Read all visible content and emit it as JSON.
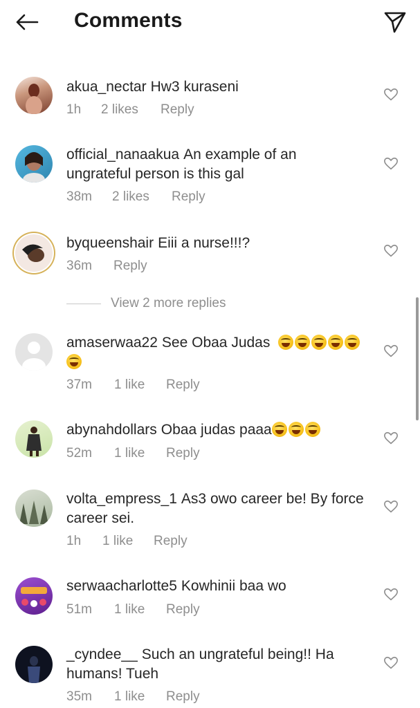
{
  "header": {
    "title": "Comments",
    "back_icon": "arrow-left-icon",
    "send_icon": "paper-plane-icon"
  },
  "comments": [
    {
      "username": "akua_nectar",
      "text": "Hw3 kuraseni",
      "time": "1h",
      "likes": "2 likes",
      "reply": "Reply",
      "avatar_colors": [
        "#7a3d2c",
        "#e8b59a"
      ]
    },
    {
      "username": "official_nanaakua",
      "text": "An example of an ungrateful person is this gal",
      "time": "38m",
      "likes": "2 likes",
      "reply": "Reply",
      "avatar_colors": [
        "#3fa0c8",
        "#b07a63"
      ]
    },
    {
      "username": "byqueenshair",
      "text": "Eiii a nurse!!!?",
      "time": "36m",
      "likes": "",
      "reply": "Reply",
      "avatar_colors": [
        "#f3e8e2",
        "#2b2b2b"
      ]
    },
    {
      "username": "amaserwaa22",
      "text": "See Obaa Judas",
      "emoji_count": 6,
      "time": "37m",
      "likes": "1 like",
      "reply": "Reply",
      "avatar_colors": [
        "#e4e4e4",
        "#ffffff"
      ]
    },
    {
      "username": "abynahdollars",
      "text": "Obaa judas paaa",
      "emoji_count": 3,
      "time": "52m",
      "likes": "1 like",
      "reply": "Reply",
      "avatar_colors": [
        "#c9e3a8",
        "#3a3a3a"
      ]
    },
    {
      "username": "volta_empress_1",
      "text": "As3 owo career be! By force career sei.",
      "time": "1h",
      "likes": "1 like",
      "reply": "Reply",
      "avatar_colors": [
        "#a9b9a0",
        "#4e5a44"
      ]
    },
    {
      "username": "serwaacharlotte5",
      "text": "Kowhinii baa wo",
      "time": "51m",
      "likes": "1 like",
      "reply": "Reply",
      "avatar_colors": [
        "#7b2fb8",
        "#f2a93b"
      ]
    },
    {
      "username": "_cyndee__",
      "text": "Such an ungrateful being!! Ha humans! Tueh",
      "time": "35m",
      "likes": "1 like",
      "reply": "Reply",
      "avatar_colors": [
        "#0e1220",
        "#3a4a7a"
      ]
    }
  ],
  "view_more_replies": "View 2 more replies",
  "heart_icon": "heart-outline-icon"
}
